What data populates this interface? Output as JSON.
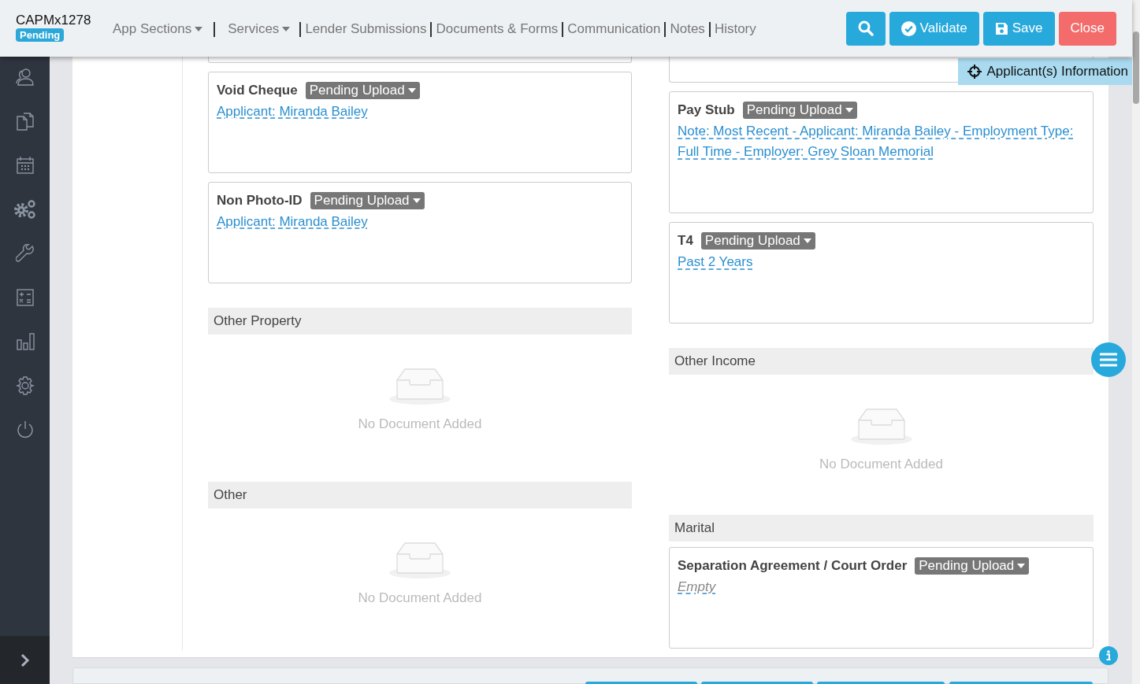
{
  "header": {
    "app_id": "CAPMx1278",
    "status": "Pending",
    "nav": [
      {
        "label": "App Sections",
        "kind": "dropdown"
      },
      {
        "label": "Services",
        "kind": "dropdown"
      },
      {
        "label": "Lender Submissions",
        "kind": "link"
      },
      {
        "label": "Documents & Forms",
        "kind": "link"
      },
      {
        "label": "Communication",
        "kind": "link"
      },
      {
        "label": "Notes",
        "kind": "link"
      },
      {
        "label": "History",
        "kind": "link"
      }
    ],
    "actions": [
      {
        "kind": "search"
      },
      {
        "kind": "validate",
        "label": "Validate"
      },
      {
        "kind": "save",
        "label": "Save"
      },
      {
        "kind": "close",
        "label": "Close"
      }
    ]
  },
  "applicant_tab": {
    "label": "Applicant(s) Information"
  },
  "columns": [
    [
      {
        "kind": "stub"
      },
      {
        "kind": "card",
        "title": "Void Cheque",
        "status": "Pending Upload",
        "links": [
          {
            "text": "Applicant: Miranda Bailey",
            "empty": false
          }
        ]
      },
      {
        "kind": "card",
        "title": "Non Photo-ID",
        "status": "Pending Upload",
        "links": [
          {
            "text": "Applicant: Miranda Bailey",
            "empty": false
          }
        ]
      },
      {
        "kind": "section",
        "title": "Other Property"
      },
      {
        "kind": "empty",
        "message": "No Document Added"
      },
      {
        "kind": "section",
        "title": "Other"
      },
      {
        "kind": "empty",
        "message": "No Document Added"
      }
    ],
    [
      {
        "kind": "stub"
      },
      {
        "kind": "card",
        "title": "Pay Stub",
        "status": "Pending Upload",
        "links": [
          {
            "text": "Note: Most Recent - Applicant: Miranda Bailey - Employment Type: Full Time - Employer: Grey Sloan Memorial",
            "empty": false
          }
        ]
      },
      {
        "kind": "card",
        "title": "T4",
        "status": "Pending Upload",
        "links": [
          {
            "text": "Past 2 Years",
            "empty": false
          }
        ]
      },
      {
        "kind": "section",
        "title": "Other Income"
      },
      {
        "kind": "empty",
        "message": "No Document Added"
      },
      {
        "kind": "section",
        "title": "Marital"
      },
      {
        "kind": "card",
        "title": "Separation Agreement / Court Order",
        "status": "Pending Upload",
        "links": [
          {
            "text": "Empty",
            "empty": true
          }
        ]
      }
    ]
  ]
}
